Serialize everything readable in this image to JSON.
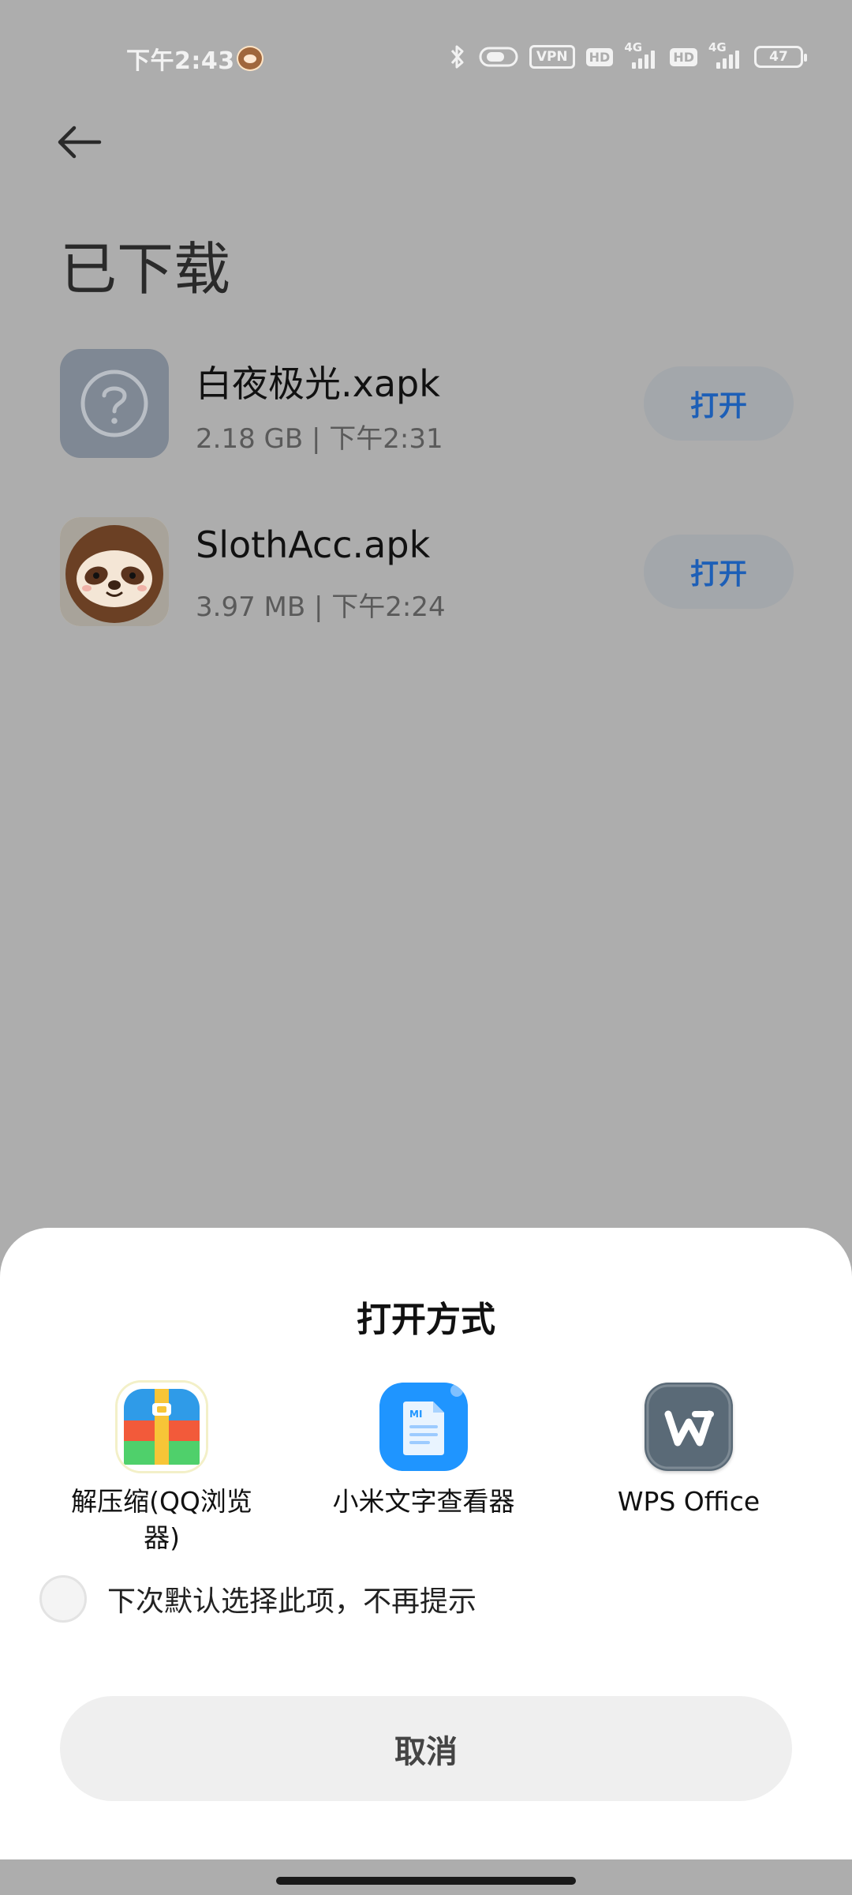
{
  "status_bar": {
    "time": "下午2:43",
    "vpn": "VPN",
    "hd1": "HD",
    "net1": "4G",
    "hd2": "HD",
    "net2": "4G",
    "battery": "47"
  },
  "page": {
    "title": "已下载",
    "back_icon": "arrow-left-icon"
  },
  "downloads": [
    {
      "name": "白夜极光.xapk",
      "meta": "2.18 GB | 下午2:31",
      "open_label": "打开",
      "icon": "unknown-file-icon"
    },
    {
      "name": "SlothAcc.apk",
      "meta": "3.97 MB | 下午2:24",
      "open_label": "打开",
      "icon": "sloth-app-icon"
    }
  ],
  "sheet": {
    "title": "打开方式",
    "apps": [
      {
        "label": "解压缩(QQ浏览器)",
        "icon": "qq-unzip-icon"
      },
      {
        "label": "小米文字查看器",
        "icon": "mi-text-viewer-icon"
      },
      {
        "label": "WPS Office",
        "icon": "wps-office-icon"
      }
    ],
    "remember_label": "下次默认选择此项，不再提示",
    "cancel_label": "取消"
  },
  "colors": {
    "accent": "#1d5fb7",
    "scrim": "#adadad",
    "sheet_bg": "#ffffff"
  }
}
